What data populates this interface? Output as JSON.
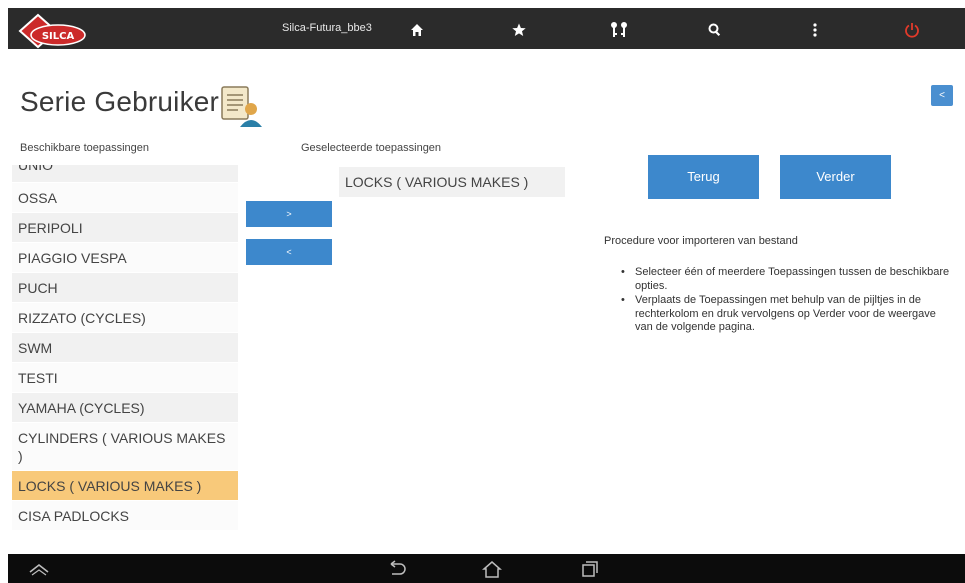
{
  "app": {
    "device_name": "Silca-Futura_bbe3",
    "logo_text": "SILCA",
    "brand_color": "#cc2a2a"
  },
  "topbar": {
    "icons": [
      "home-icon",
      "star-icon",
      "keys-icon",
      "search-icon",
      "more-icon",
      "power-icon"
    ],
    "power_color": "#e23a2a"
  },
  "page": {
    "title": "Serie Gebruiker",
    "back_button_label": "<"
  },
  "available": {
    "header": "Beschikbare toepassingen",
    "items": [
      "UNIO",
      "OSSA",
      "PERIPOLI",
      "PIAGGIO VESPA",
      "PUCH",
      "RIZZATO (CYCLES)",
      "SWM",
      "TESTI",
      "YAMAHA (CYCLES)",
      "CYLINDERS ( VARIOUS MAKES )",
      "LOCKS ( VARIOUS MAKES )",
      "CISA PADLOCKS"
    ],
    "selected_index": 10
  },
  "transfer": {
    "add_label": ">",
    "remove_label": "<"
  },
  "selected": {
    "header": "Geselecteerde toepassingen",
    "items": [
      "LOCKS ( VARIOUS MAKES )"
    ]
  },
  "actions": {
    "back_label": "Terug",
    "next_label": "Verder",
    "color": "#3d88cc"
  },
  "procedure": {
    "title": "Procedure voor importeren van bestand",
    "steps": [
      "Selecteer één of meerdere Toepassingen tussen de beschikbare opties.",
      "Verplaats de Toepassingen met behulp van de pijltjes in de rechterkolom en druk vervolgens op Verder voor de weergave van de volgende pagina."
    ]
  },
  "navbar": {
    "icons": [
      "chevron-up-icon",
      "back-icon",
      "home-outline-icon",
      "recent-apps-icon"
    ]
  },
  "colors": {
    "selected_item": "#f8c97a",
    "topbar": "#2b2b2b"
  }
}
